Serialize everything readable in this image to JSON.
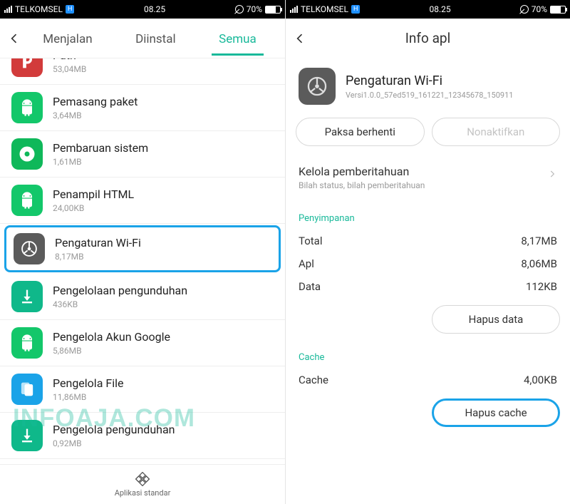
{
  "status": {
    "carrier": "TELKOMSEL",
    "network_badge": "H",
    "time": "08.25",
    "battery_pct": "70%"
  },
  "left": {
    "tabs": {
      "running": "Menjalan",
      "installed": "Diinstal",
      "all": "Semua"
    },
    "apps": [
      {
        "name": "Path",
        "size": "53,04MB",
        "icon": "path",
        "bg": "bg-red"
      },
      {
        "name": "Pemasang paket",
        "size": "3,64MB",
        "icon": "android",
        "bg": "bg-green"
      },
      {
        "name": "Pembaruan sistem",
        "size": "1,61MB",
        "icon": "disc",
        "bg": "bg-dgreen"
      },
      {
        "name": "Penampil HTML",
        "size": "24,00KB",
        "icon": "android",
        "bg": "bg-green"
      },
      {
        "name": "Pengaturan Wi-Fi",
        "size": "8,17MB",
        "icon": "wheel",
        "bg": "bg-gray",
        "selected": true
      },
      {
        "name": "Pengelolaan pengunduhan",
        "size": "436KB",
        "icon": "download",
        "bg": "bg-teal"
      },
      {
        "name": "Pengelola Akun Google",
        "size": "5,86MB",
        "icon": "android",
        "bg": "bg-green"
      },
      {
        "name": "Pengelola File",
        "size": "11,86MB",
        "icon": "files",
        "bg": "bg-blue"
      },
      {
        "name": "Pengelola pengunduhan",
        "size": "0,92MB",
        "icon": "download",
        "bg": "bg-teal"
      }
    ],
    "bottom_label": "Aplikasi standar"
  },
  "right": {
    "header_title": "Info apl",
    "app": {
      "name": "Pengaturan Wi-Fi",
      "version": "Versi1.0.0_57ed519_161221_12345678_150911"
    },
    "buttons": {
      "force_stop": "Paksa berhenti",
      "disable": "Nonaktifkan",
      "clear_data": "Hapus data",
      "clear_cache": "Hapus cache"
    },
    "notif": {
      "label": "Kelola pemberitahuan",
      "sub": "Bilah status, bilah pemberitahuan"
    },
    "sections": {
      "storage": "Penyimpanan",
      "cache": "Cache"
    },
    "storage": {
      "total_k": "Total",
      "total_v": "8,17MB",
      "app_k": "Apl",
      "app_v": "8,06MB",
      "data_k": "Data",
      "data_v": "112KB"
    },
    "cache": {
      "k": "Cache",
      "v": "4,00KB"
    }
  },
  "watermark": "INFOAJA.COM"
}
